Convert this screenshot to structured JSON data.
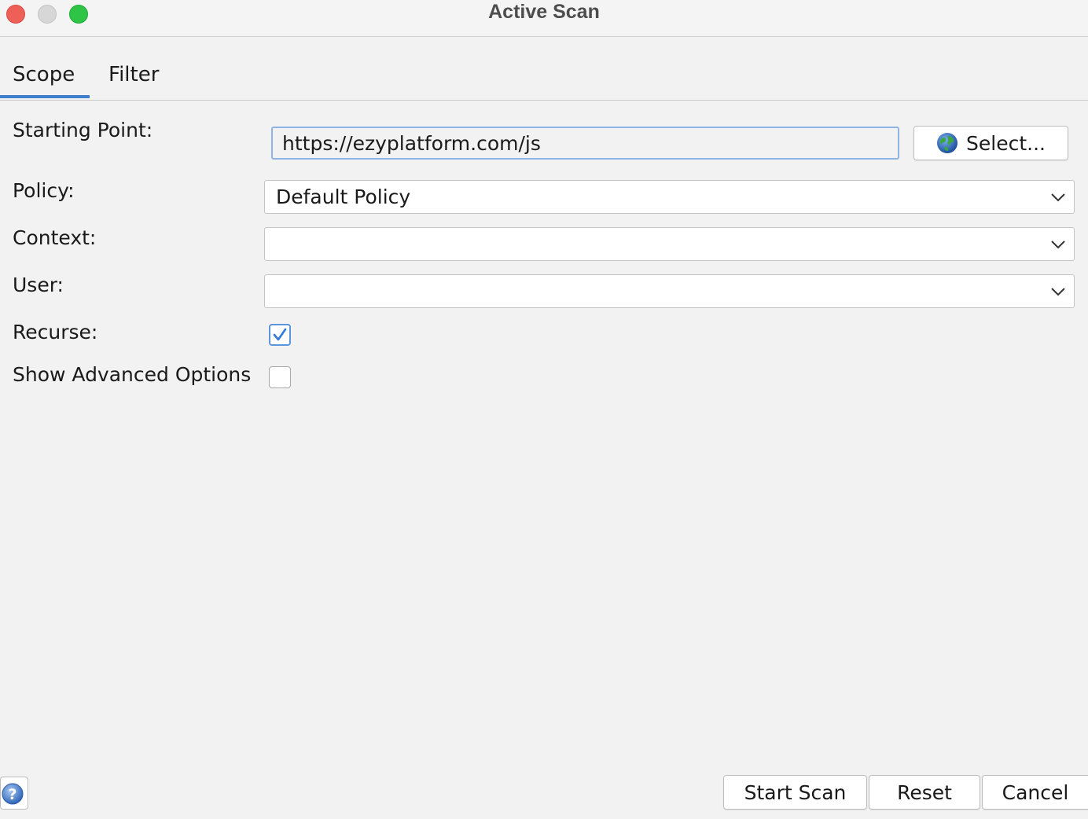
{
  "window": {
    "title": "Active Scan"
  },
  "tabs": [
    {
      "label": "Scope",
      "selected": true
    },
    {
      "label": "Filter",
      "selected": false
    }
  ],
  "form": {
    "starting_point": {
      "label": "Starting Point:",
      "value": "https://ezyplatform.com/js"
    },
    "select_button": {
      "label": "Select...",
      "icon": "globe-icon"
    },
    "policy": {
      "label": "Policy:",
      "value": "Default Policy"
    },
    "context": {
      "label": "Context:",
      "value": ""
    },
    "user": {
      "label": "User:",
      "value": ""
    },
    "recurse": {
      "label": "Recurse:",
      "checked": true
    },
    "advanced": {
      "label": "Show Advanced Options",
      "checked": false
    }
  },
  "footer": {
    "help_icon": "help-icon",
    "start_label": "Start Scan",
    "reset_label": "Reset",
    "cancel_label": "Cancel"
  },
  "colors": {
    "accent": "#3e7fd0",
    "focus_border": "#8fb4e4",
    "check": "#2f7ad8",
    "close": "#ee5f58",
    "minimize": "#d7d7d7",
    "maximize": "#2ec445"
  }
}
